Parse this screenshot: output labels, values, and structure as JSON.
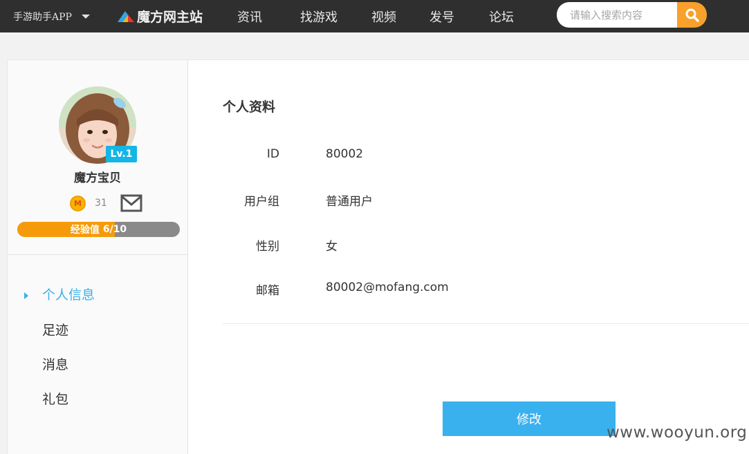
{
  "topbar": {
    "app_download": "手游助手APP",
    "logo_text": "魔方网主站",
    "nav": [
      "资讯",
      "找游戏",
      "视频",
      "发号",
      "论坛"
    ],
    "search_placeholder": "请输入搜索内容"
  },
  "profile": {
    "username": "魔方宝贝",
    "level": "Lv.1",
    "coin_letter": "M",
    "coins": "31",
    "exp_label": "经验值",
    "exp_value": "6/10",
    "exp_fraction": 0.6
  },
  "side_menu": [
    "个人信息",
    "足迹",
    "消息",
    "礼包"
  ],
  "main": {
    "section_title": "个人资料",
    "fields": [
      {
        "label": "ID",
        "value": "80002"
      },
      {
        "label": "用户组",
        "value": "普通用户"
      },
      {
        "label": "性别",
        "value": "女"
      },
      {
        "label": "邮箱",
        "value": "80002@mofang.com"
      }
    ],
    "edit_button": "修改"
  },
  "watermark": "www.wooyun.org",
  "colors": {
    "topbar_bg": "#2f2f2f",
    "accent_blue": "#3ab1ef",
    "search_orange": "#f7a02c",
    "level_badge": "#14b6e6",
    "exp_orange": "#f59b0b"
  },
  "icons": [
    "caret-down-icon",
    "mofang-logo-icon",
    "search-icon",
    "coin-icon",
    "mail-icon",
    "menu-arrow-icon"
  ]
}
